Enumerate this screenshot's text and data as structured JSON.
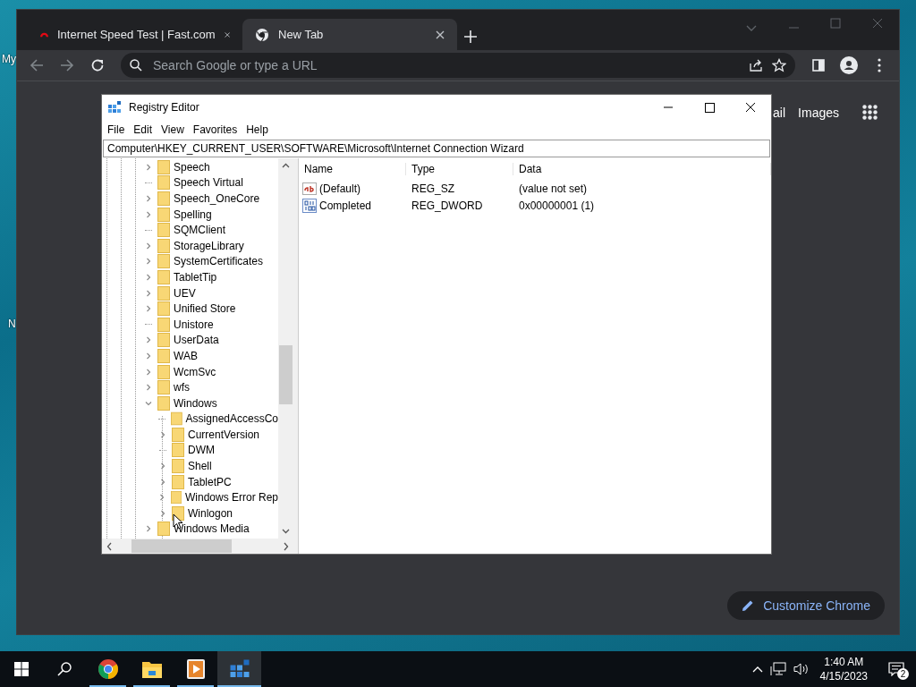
{
  "desktop_icons": [
    {
      "label": "My"
    },
    {
      "label": "N"
    }
  ],
  "browser": {
    "tabs": [
      {
        "title": "Internet Speed Test | Fast.com",
        "selected": false,
        "kind": "fast"
      },
      {
        "title": "New Tab",
        "selected": true,
        "kind": "chrome"
      }
    ],
    "omnibox": {
      "placeholder": "Search Google or type a URL"
    },
    "links": [
      "ail",
      "Images"
    ],
    "customize_button": "Customize Chrome"
  },
  "registry_editor": {
    "title": "Registry Editor",
    "menu": [
      "File",
      "Edit",
      "View",
      "Favorites",
      "Help"
    ],
    "address": "Computer\\HKEY_CURRENT_USER\\SOFTWARE\\Microsoft\\Internet Connection Wizard",
    "tree": [
      {
        "label": "Speech",
        "expandable": true,
        "expanded": false
      },
      {
        "label": "Speech Virtual",
        "expandable": false
      },
      {
        "label": "Speech_OneCore",
        "expandable": true,
        "expanded": false
      },
      {
        "label": "Spelling",
        "expandable": true,
        "expanded": false
      },
      {
        "label": "SQMClient",
        "expandable": false
      },
      {
        "label": "StorageLibrary",
        "expandable": true,
        "expanded": false
      },
      {
        "label": "SystemCertificates",
        "expandable": true,
        "expanded": false
      },
      {
        "label": "TabletTip",
        "expandable": true,
        "expanded": false
      },
      {
        "label": "UEV",
        "expandable": true,
        "expanded": false
      },
      {
        "label": "Unified Store",
        "expandable": true,
        "expanded": false
      },
      {
        "label": "Unistore",
        "expandable": false
      },
      {
        "label": "UserData",
        "expandable": true,
        "expanded": false
      },
      {
        "label": "WAB",
        "expandable": true,
        "expanded": false
      },
      {
        "label": "WcmSvc",
        "expandable": true,
        "expanded": false
      },
      {
        "label": "wfs",
        "expandable": true,
        "expanded": false
      },
      {
        "label": "Windows",
        "expandable": true,
        "expanded": true,
        "children": [
          {
            "label": "AssignedAccessCo",
            "expandable": false
          },
          {
            "label": "CurrentVersion",
            "expandable": true,
            "expanded": false
          },
          {
            "label": "DWM",
            "expandable": false
          },
          {
            "label": "Shell",
            "expandable": true,
            "expanded": false
          },
          {
            "label": "TabletPC",
            "expandable": true,
            "expanded": false
          },
          {
            "label": "Windows Error Rep",
            "expandable": true,
            "expanded": false
          },
          {
            "label": "Winlogon",
            "expandable": true,
            "expanded": false
          }
        ]
      },
      {
        "label": "Windows Media",
        "expandable": true,
        "expanded": false
      }
    ],
    "columns": [
      "Name",
      "Type",
      "Data"
    ],
    "values": [
      {
        "kind": "string",
        "name": "(Default)",
        "type": "REG_SZ",
        "data": "(value not set)"
      },
      {
        "kind": "binary",
        "name": "Completed",
        "type": "REG_DWORD",
        "data": "0x00000001 (1)"
      }
    ]
  },
  "taskbar": {
    "apps": [
      {
        "kind": "chrome",
        "running": true,
        "selected": false
      },
      {
        "kind": "explorer",
        "running": true,
        "selected": false
      },
      {
        "kind": "media",
        "running": true,
        "selected": false
      },
      {
        "kind": "regedit",
        "running": true,
        "selected": true
      }
    ],
    "time": "1:40 AM",
    "date": "4/15/2023",
    "notification_count": "2"
  }
}
